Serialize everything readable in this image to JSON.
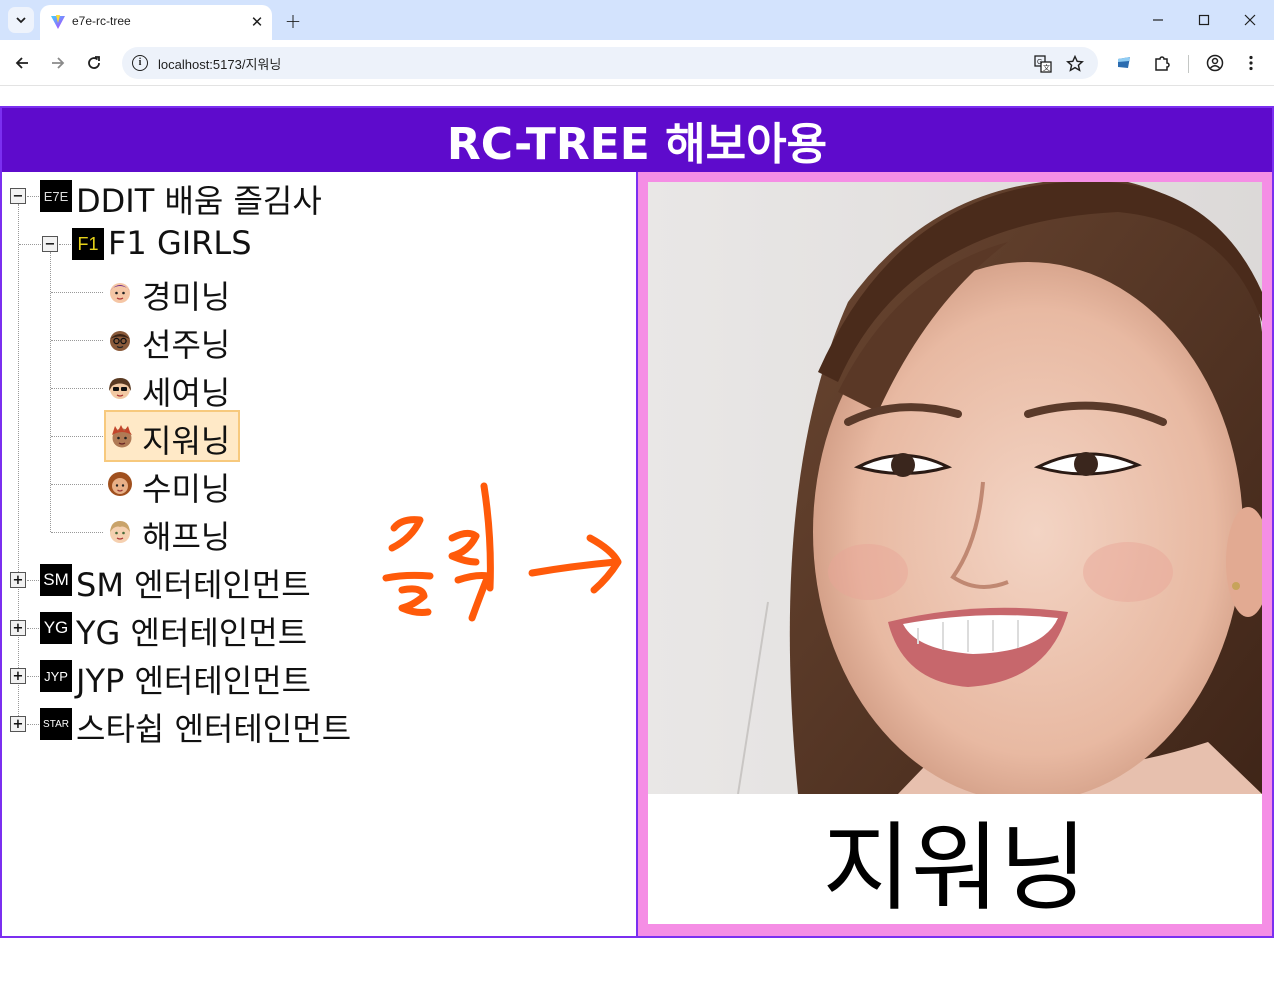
{
  "browser": {
    "tab_title": "e7e-rc-tree",
    "url": "localhost:5173/지워닝",
    "tab_close_glyph": "✕",
    "new_tab_glyph": "+",
    "icons": {
      "tab_list": "chevron-down-icon",
      "back": "arrow-left-icon",
      "forward": "arrow-right-icon",
      "reload": "reload-icon",
      "site_info": "info-icon",
      "translate": "translate-icon",
      "bookmark": "star-icon",
      "extension_app": "app-extension-icon",
      "extensions": "puzzle-icon",
      "profile": "profile-icon",
      "menu": "kebab-menu-icon",
      "minimize": "minimize-icon",
      "maximize": "maximize-icon",
      "close": "close-icon"
    }
  },
  "page": {
    "title": "RC-TREE 해보아용",
    "colors": {
      "header_bg": "#5e0bcc",
      "border": "#7b2ff0",
      "detail_bg": "#f58ee5",
      "selected_bg": "#ffe9c7",
      "selected_border": "#f7c97d",
      "annotation": "#ff5a0a"
    }
  },
  "tree": {
    "root": {
      "badge": "E7E",
      "label": "DDIT 배움 즐김사",
      "expanded": true,
      "child_group": {
        "badge": "F1",
        "label": "F1 GIRLS",
        "expanded": true,
        "members": [
          {
            "label": "경미닝",
            "avatar": "purple-hair-avatar-icon"
          },
          {
            "label": "선주닝",
            "avatar": "glasses-avatar-icon"
          },
          {
            "label": "세여닝",
            "avatar": "sunglasses-avatar-icon"
          },
          {
            "label": "지워닝",
            "avatar": "red-hair-avatar-icon",
            "selected": true
          },
          {
            "label": "수미닝",
            "avatar": "curly-hair-avatar-icon"
          },
          {
            "label": "해프닝",
            "avatar": "blonde-avatar-icon"
          }
        ]
      }
    },
    "collapsed": [
      {
        "badge": "SM",
        "label": "SM 엔터테인먼트"
      },
      {
        "badge": "YG",
        "label": "YG 엔터테인먼트"
      },
      {
        "badge": "JYP",
        "label": "JYP 엔터테인먼트"
      },
      {
        "badge": "STAR",
        "label": "스타쉽 엔터테인먼트"
      }
    ],
    "switcher_open": "−",
    "switcher_closed": "+"
  },
  "detail": {
    "name": "지워닝"
  },
  "annotation": {
    "text": "클릭",
    "arrow": "arrow-right-icon"
  }
}
